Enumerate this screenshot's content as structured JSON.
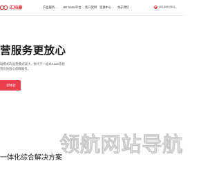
{
  "brand": {
    "name": "汇柏康",
    "accent_color": "#e0333c"
  },
  "nav": {
    "items": [
      {
        "label": "产品服务",
        "has_dropdown": true
      },
      {
        "label": "HR SaaS平台",
        "has_dropdown": true
      },
      {
        "label": "客户案例",
        "has_dropdown": false
      },
      {
        "label": "资源中心",
        "has_dropdown": true
      },
      {
        "label": "关于我们",
        "has_dropdown": true
      }
    ],
    "dropdown_icon": "chevron-down-icon"
  },
  "contact": {
    "phone_icon": "phone-icon",
    "phone": "400-869-9151"
  },
  "hero": {
    "title": "营服务更放心",
    "desc_line1": "站模式的运营模式设计，依托于一站式SaaS系统",
    "desc_line2": "营优效放心保障服务。",
    "cta_label": "即体验",
    "cta_color": "#ea3f4c"
  },
  "watermark": "领航网站导航",
  "section": {
    "title": "一体化综合解决方案"
  }
}
